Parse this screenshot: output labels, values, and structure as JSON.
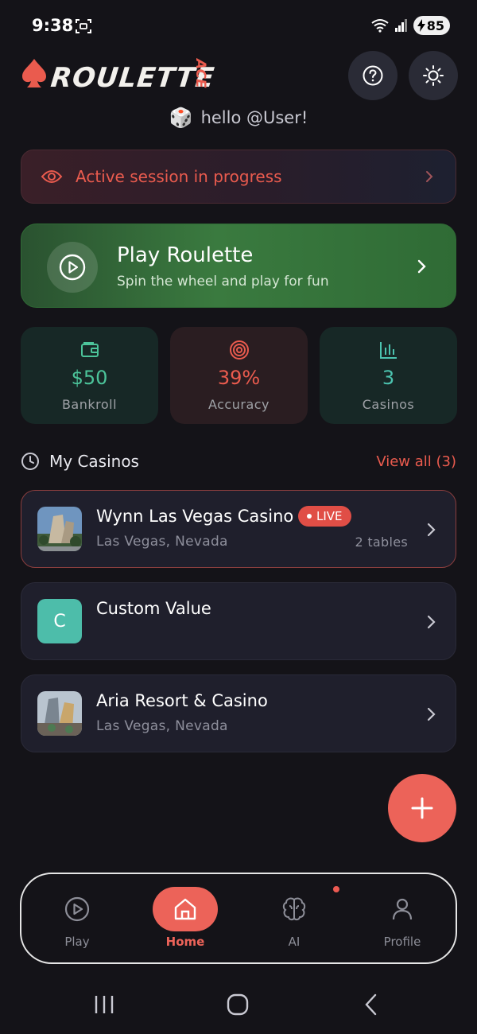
{
  "status_bar": {
    "time": "9:38",
    "battery": "85"
  },
  "header": {
    "logo_text": "ROULETTE",
    "logo_accent": "ACE",
    "greeting": "hello @User!",
    "greeting_emoji": "🎲"
  },
  "session_banner": {
    "text": "Active session in progress"
  },
  "play_card": {
    "title": "Play Roulette",
    "subtitle": "Spin the wheel and play for fun"
  },
  "stats": [
    {
      "value": "$50",
      "label": "Bankroll",
      "icon": "wallet-icon",
      "color": "#4cc49a"
    },
    {
      "value": "39%",
      "label": "Accuracy",
      "icon": "target-icon",
      "color": "#ea5b4e"
    },
    {
      "value": "3",
      "label": "Casinos",
      "icon": "bar-chart-icon",
      "color": "#4cc4b0"
    }
  ],
  "my_casinos": {
    "title": "My Casinos",
    "view_all": "View all (3)",
    "items": [
      {
        "name": "Wynn Las Vegas Casino",
        "location": "Las Vegas, Nevada",
        "tables": "2 tables",
        "badge": "LIVE"
      },
      {
        "name": "Custom Value",
        "avatar_letter": "C"
      },
      {
        "name": "Aria Resort & Casino",
        "location": "Las Vegas, Nevada"
      }
    ]
  },
  "bottom_nav": [
    {
      "label": "Play"
    },
    {
      "label": "Home"
    },
    {
      "label": "AI"
    },
    {
      "label": "Profile"
    }
  ],
  "colors": {
    "accent": "#ec6359",
    "background": "#141318",
    "card": "#1f1f2c",
    "green": "#3a7a3f"
  }
}
